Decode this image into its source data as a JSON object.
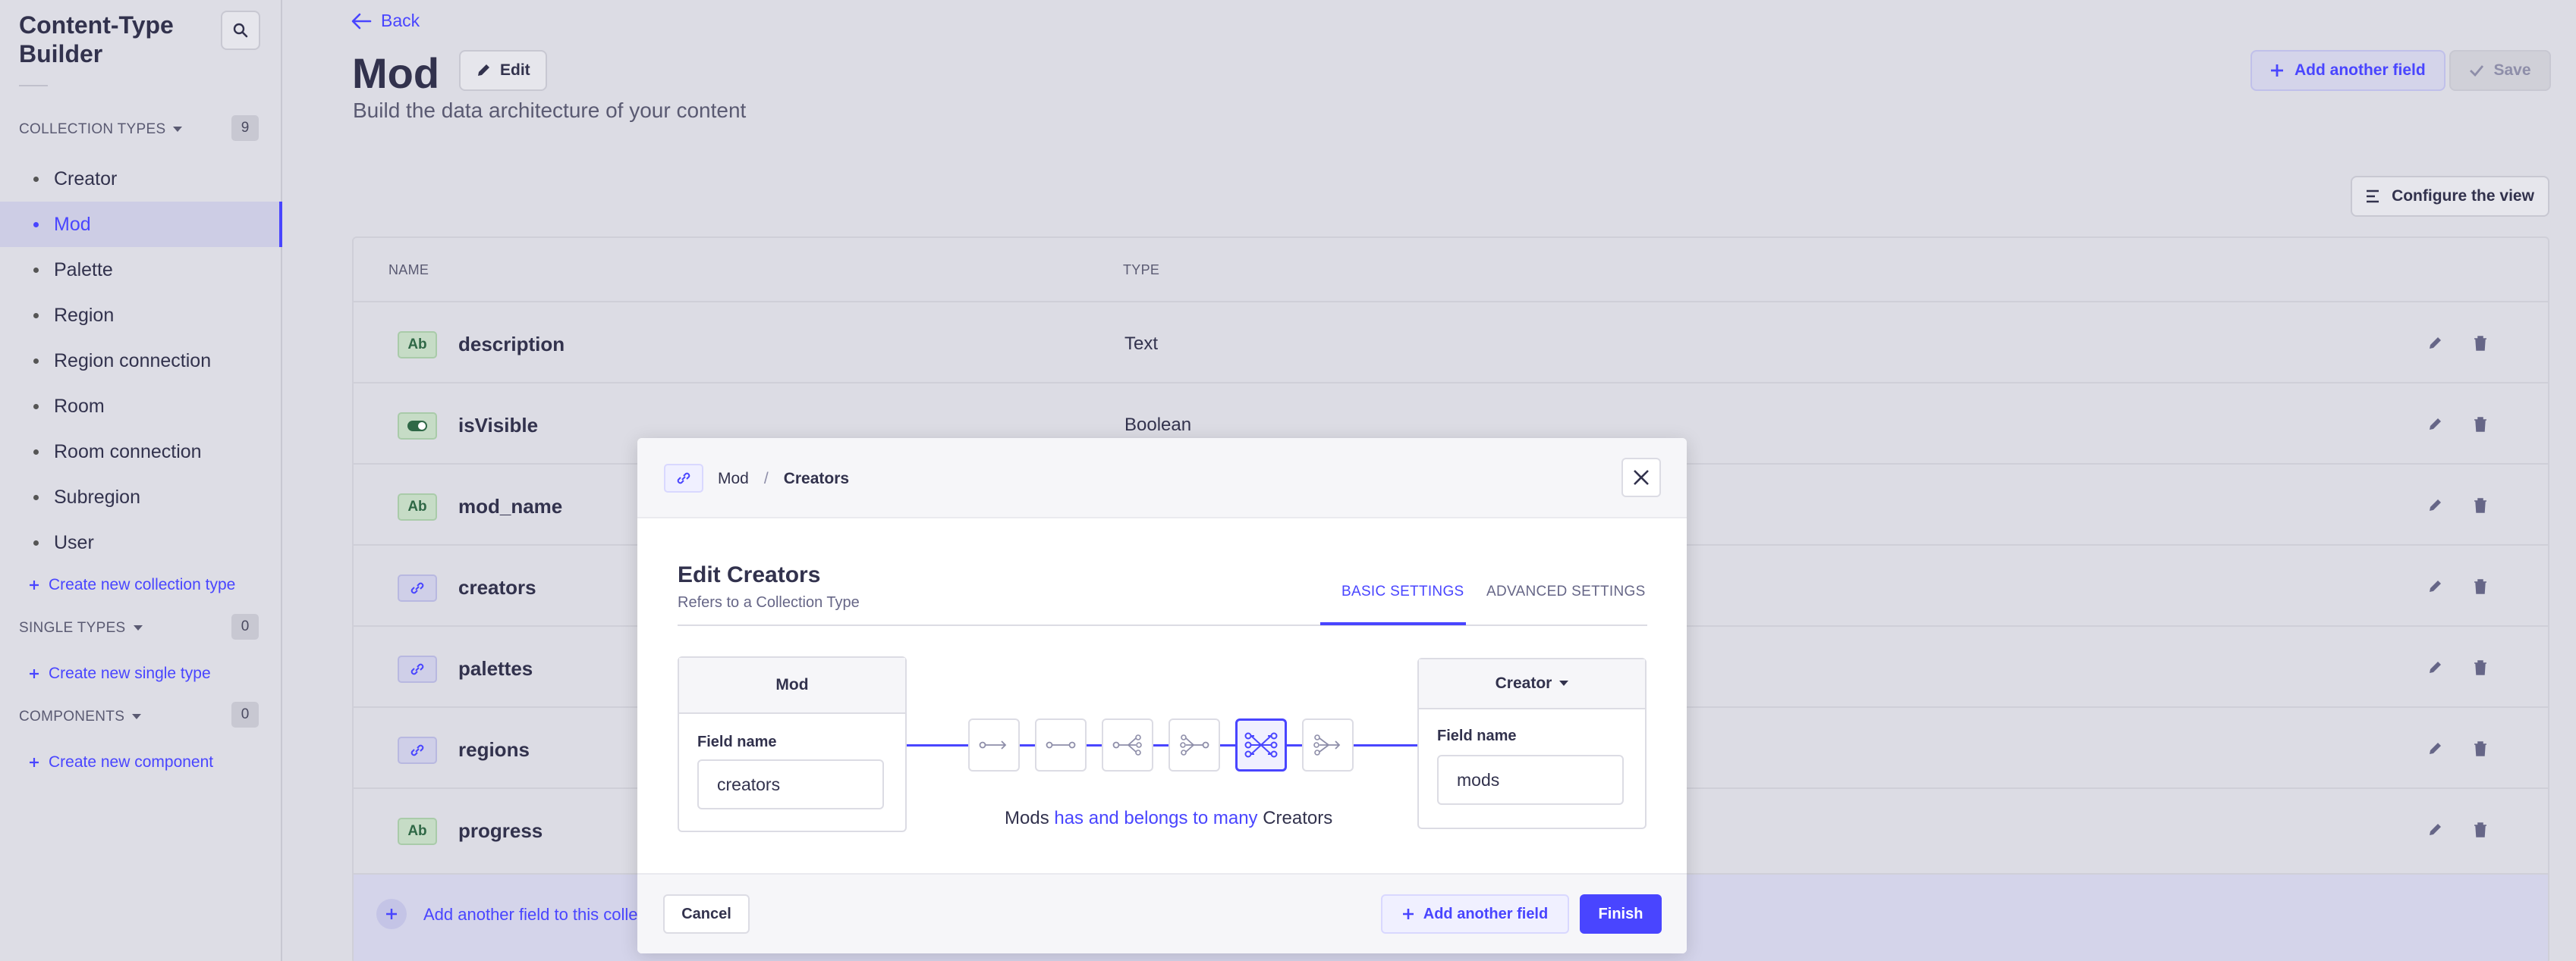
{
  "sidebar": {
    "title": "Content-Type Builder",
    "collection_label": "COLLECTION TYPES",
    "collection_count": "9",
    "collection_items": [
      "Creator",
      "Mod",
      "Palette",
      "Region",
      "Region connection",
      "Room",
      "Room connection",
      "Subregion",
      "User"
    ],
    "active_item": "Mod",
    "create_collection": "Create new collection type",
    "single_label": "SINGLE TYPES",
    "single_count": "0",
    "create_single": "Create new single type",
    "components_label": "COMPONENTS",
    "components_count": "0",
    "create_component": "Create new component"
  },
  "header": {
    "back": "Back",
    "title": "Mod",
    "edit": "Edit",
    "subtitle": "Build the data architecture of your content",
    "add_field": "Add another field",
    "save": "Save",
    "configure": "Configure the view"
  },
  "table": {
    "col_name": "NAME",
    "col_type": "TYPE",
    "rows": [
      {
        "name": "description",
        "type": "Text",
        "icon": "text-icon",
        "badge": "Ab"
      },
      {
        "name": "isVisible",
        "type": "Boolean",
        "icon": "boolean-icon",
        "badge": ""
      },
      {
        "name": "mod_name",
        "type": "",
        "icon": "text-icon",
        "badge": "Ab"
      },
      {
        "name": "creators",
        "type": "",
        "icon": "relation-icon",
        "badge": ""
      },
      {
        "name": "palettes",
        "type": "",
        "icon": "relation-icon",
        "badge": ""
      },
      {
        "name": "regions",
        "type": "",
        "icon": "relation-icon",
        "badge": ""
      },
      {
        "name": "progress",
        "type": "",
        "icon": "text-icon",
        "badge": "Ab"
      }
    ],
    "footer_add": "Add another field to this collec"
  },
  "modal": {
    "crumb_parent": "Mod",
    "crumb_sep": "/",
    "crumb_current": "Creators",
    "title": "Edit Creators",
    "subtitle": "Refers to a Collection Type",
    "tab_basic": "BASIC SETTINGS",
    "tab_advanced": "ADVANCED SETTINGS",
    "left_box_title": "Mod",
    "left_field_label": "Field name",
    "left_field_value": "creators",
    "right_box_title": "Creator",
    "right_field_label": "Field name",
    "right_field_value": "mods",
    "relation_types": [
      "one-way-icon",
      "one-to-one-icon",
      "one-to-many-icon",
      "many-to-one-icon",
      "many-to-many-icon",
      "many-way-icon"
    ],
    "active_relation": "many-to-many-icon",
    "sentence_start": "Mods",
    "sentence_highlight": "has and belongs to many",
    "sentence_end": "Creators",
    "cancel": "Cancel",
    "add_another": "Add another field",
    "finish": "Finish"
  },
  "colors": {
    "accent": "#4945ff",
    "overlay": "#dcdce4",
    "text": "#32324d"
  }
}
